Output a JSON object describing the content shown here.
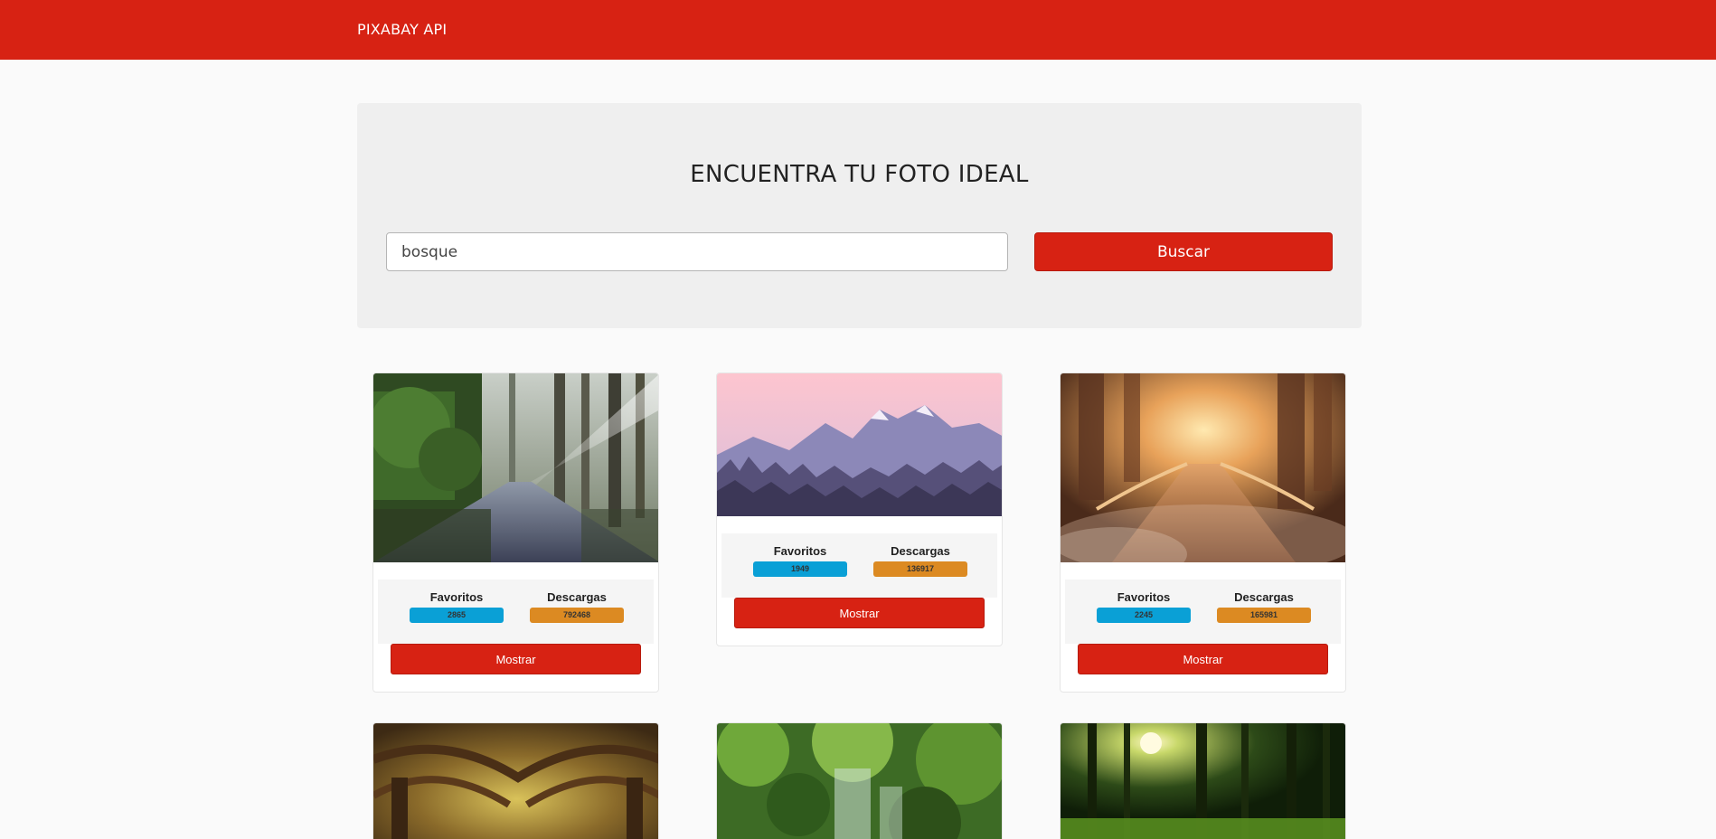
{
  "header": {
    "brand": "PIXABAY API"
  },
  "search": {
    "title": "ENCUENTRA TU FOTO IDEAL",
    "value": "bosque",
    "button_label": "Buscar"
  },
  "colors": {
    "primary": "#d72213",
    "favorites_badge": "#0aa0d6",
    "downloads_badge": "#dc8a22"
  },
  "results": [
    {
      "favorites_label": "Favoritos",
      "favorites": "2865",
      "downloads_label": "Descargas",
      "downloads": "792468",
      "button_label": "Mostrar",
      "image": "forest-road-with-sunbeams"
    },
    {
      "favorites_label": "Favoritos",
      "favorites": "1949",
      "downloads_label": "Descargas",
      "downloads": "136917",
      "button_label": "Mostrar",
      "image": "pink-sky-mountains-forest"
    },
    {
      "favorites_label": "Favoritos",
      "favorites": "2245",
      "downloads_label": "Descargas",
      "downloads": "165981",
      "button_label": "Mostrar",
      "image": "misty-wooden-bridge"
    },
    {
      "image": "tree-tunnel"
    },
    {
      "image": "green-waterfall"
    },
    {
      "image": "sunlit-forest"
    }
  ]
}
